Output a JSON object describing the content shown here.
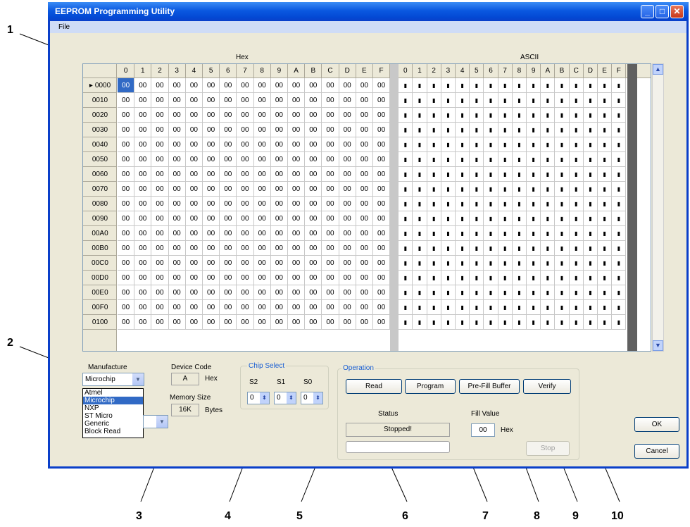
{
  "callouts": [
    "1",
    "2",
    "3",
    "4",
    "5",
    "6",
    "7",
    "8",
    "9",
    "10"
  ],
  "window": {
    "title": "EEPROM Programming Utility",
    "buttons": {
      "minimize": "_",
      "maximize": "□",
      "close": "✕"
    }
  },
  "menu": {
    "file": "File"
  },
  "grid": {
    "hex_label": "Hex",
    "ascii_label": "ASCII",
    "hex_columns": [
      "0",
      "1",
      "2",
      "3",
      "4",
      "5",
      "6",
      "7",
      "8",
      "9",
      "A",
      "B",
      "C",
      "D",
      "E",
      "F"
    ],
    "ascii_columns": [
      "0",
      "1",
      "2",
      "3",
      "4",
      "5",
      "6",
      "7",
      "8",
      "9",
      "A",
      "B",
      "C",
      "D",
      "E",
      "F"
    ],
    "current_row_marker": "▸",
    "rows": [
      "0000",
      "0010",
      "0020",
      "0030",
      "0040",
      "0050",
      "0060",
      "0070",
      "0080",
      "0090",
      "00A0",
      "00B0",
      "00C0",
      "00D0",
      "00E0",
      "00F0",
      "0100"
    ],
    "hex_value": "00",
    "ascii_value": "▮",
    "scroll_up": "▲",
    "scroll_down": "▼"
  },
  "manufacture": {
    "label": "Manufacture",
    "selected": "Microchip",
    "arrow": "▼",
    "options": [
      "Atmel",
      "Microchip",
      "NXP",
      "ST Micro",
      "Generic",
      "Block Read"
    ],
    "highlighted_index": 1
  },
  "device": {
    "code_label": "Device Code",
    "code_value": "A",
    "code_unit": "Hex",
    "size_label": "Memory Size",
    "size_value": "16K",
    "size_unit": "Bytes"
  },
  "chip_select": {
    "label": "Chip Select",
    "fields": [
      {
        "name": "S2",
        "value": "0"
      },
      {
        "name": "S1",
        "value": "0"
      },
      {
        "name": "S0",
        "value": "0"
      }
    ],
    "spin": "⬍"
  },
  "operation": {
    "label": "Operation",
    "read": "Read",
    "program": "Program",
    "prefill": "Pre-Fill Buffer",
    "verify": "Verify",
    "status_label": "Status",
    "status_value": "Stopped!",
    "fill_label": "Fill Value",
    "fill_value": "00",
    "fill_unit": "Hex",
    "stop": "Stop"
  },
  "dialog": {
    "ok": "OK",
    "cancel": "Cancel"
  }
}
